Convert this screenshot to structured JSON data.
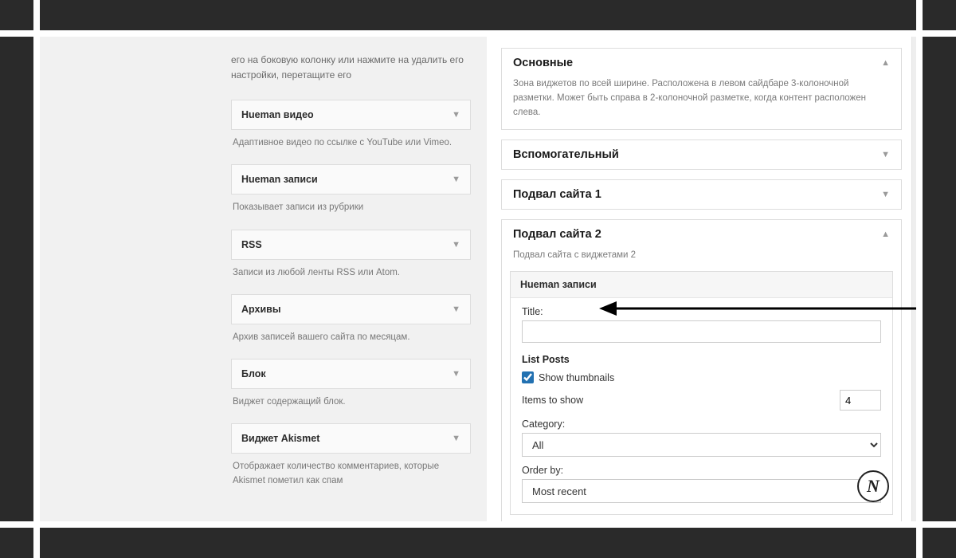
{
  "left": {
    "intro": "его на боковую колонку или нажмите на удалить его настройки, перетащите его",
    "widgets": [
      {
        "label": "Hueman видео",
        "desc": "Адаптивное видео по ссылке с YouTube или Vimeo."
      },
      {
        "label": "Hueman записи",
        "desc": "Показывает записи из рубрики"
      },
      {
        "label": "RSS",
        "desc": "Записи из любой ленты RSS или Atom."
      },
      {
        "label": "Архивы",
        "desc": "Архив записей вашего сайта по месяцам."
      },
      {
        "label": "Блок",
        "desc": "Виджет содержащий блок."
      },
      {
        "label": "Виджет Akismet",
        "desc": "Отображает количество комментариев, которые Akismet пометил как спам"
      }
    ]
  },
  "right": {
    "areas": {
      "main": {
        "title": "Основные",
        "desc": "Зона виджетов по всей ширине. Расположена в левом сайдбаре 3-колоночной разметки. Может быть справа в 2-колоночной разметке, когда контент расположен слева."
      },
      "aux": {
        "title": "Вспомогательный"
      },
      "footer1": {
        "title": "Подвал сайта 1"
      },
      "footer2": {
        "title": "Подвал сайта 2",
        "desc": "Подвал сайта с виджетами 2",
        "widget": {
          "title": "Hueman записи",
          "form": {
            "title_label": "Title:",
            "title_value": "",
            "section_label": "List Posts",
            "show_thumbs_label": "Show thumbnails",
            "show_thumbs_checked": true,
            "items_label": "Items to show",
            "items_value": "4",
            "category_label": "Category:",
            "category_value": "All",
            "order_label": "Order by:",
            "order_value": "Most recent"
          }
        }
      }
    }
  },
  "logo_letter": "N"
}
